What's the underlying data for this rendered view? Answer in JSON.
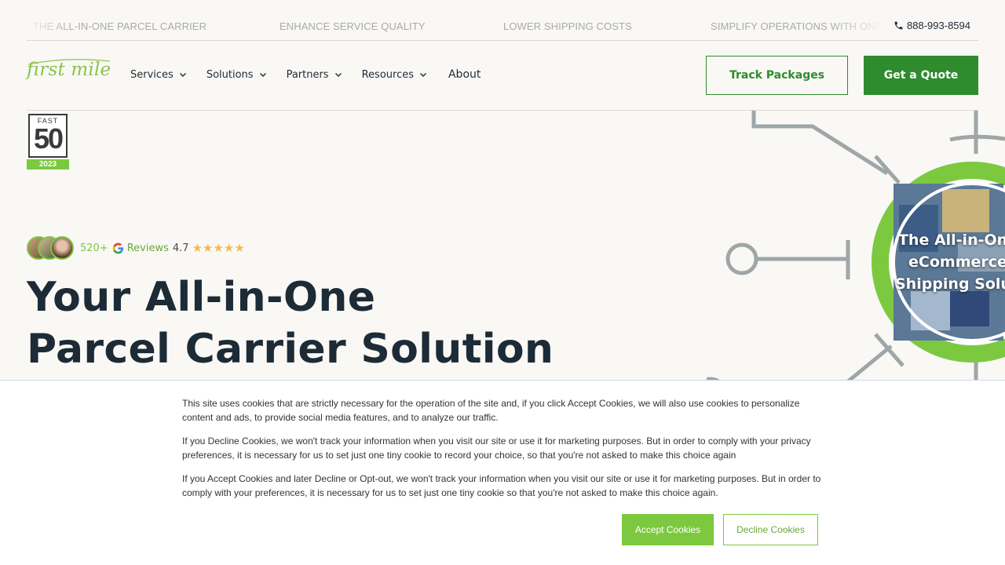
{
  "ticker": {
    "items": [
      "THE ALL-IN-ONE PARCEL CARRIER",
      "ENHANCE SERVICE QUALITY",
      "LOWER SHIPPING COSTS",
      "SIMPLIFY OPERATIONS WITH ONE"
    ],
    "phone": "888-993-8594"
  },
  "nav": {
    "logo": "first mile",
    "menu": [
      "Services",
      "Solutions",
      "Partners",
      "Resources"
    ],
    "about": "About",
    "track_label": "Track Packages",
    "quote_label": "Get a Quote"
  },
  "badge": {
    "top": "FAST",
    "number": "50",
    "year": "2023"
  },
  "reviews": {
    "count": "520+",
    "label": "Reviews",
    "score": "4.7",
    "stars": "★★★★★"
  },
  "hero": {
    "headline_line1": "Your All-in-One",
    "headline_line2": "Parcel Carrier Solution",
    "circle_line1": "The All-in-One",
    "circle_line2": "eCommerce",
    "circle_line3": "Shipping Solution"
  },
  "cookie": {
    "p1": "This site uses cookies that are strictly necessary for the operation of the site and, if you click Accept Cookies, we will also use cookies to personalize content and ads, to provide social media features, and to analyze our traffic.",
    "p2": "If you Decline Cookies, we won't track your information when you visit our site or use it for marketing purposes. But in order to comply with your privacy preferences, it is necessary for us to set just one tiny cookie to record your choice, so that you're not asked to make this choice again",
    "p3": "If you Accept Cookies and later Decline or Opt-out, we won't track your information when you visit our site or use it for marketing purposes. But in order to comply with your preferences, it is necessary for us to set just one tiny cookie so that you're not asked to make this choice again.",
    "accept_label": "Accept Cookies",
    "decline_label": "Decline Cookies"
  },
  "colors": {
    "brand_green": "#2e8b2e",
    "accent_green": "#7cc940",
    "text_dark": "#1d2b36",
    "background": "#f9f8f5"
  },
  "icons": [
    "phone-icon",
    "chevron-down-icon",
    "google-icon",
    "star-icon"
  ]
}
